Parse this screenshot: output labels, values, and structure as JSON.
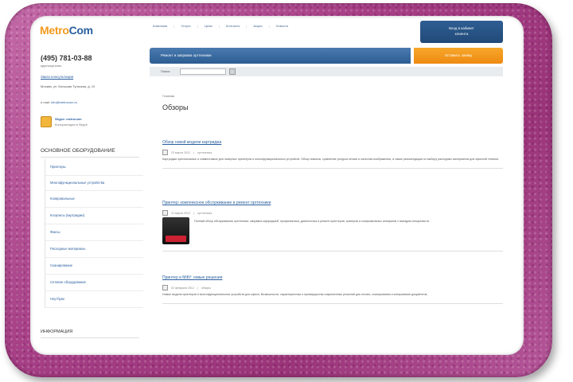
{
  "header": {
    "logo_part1": "Metro",
    "logo_part2": "Com",
    "nav": [
      "Компания",
      "Услуги",
      "Цены",
      "Контакты",
      "Акции",
      "Новости"
    ],
    "login_title": "Вход в кабинет",
    "login_sub": "клиента"
  },
  "contacts": {
    "phone": "(495) 781-03-88",
    "phone_sub": "круглосуточно",
    "order_link": "Заказ консультации",
    "address": "Москва, ул. Большая Тульская, д. 10",
    "email_label": "e-mail:",
    "email": "info@metrocom.ru",
    "skype_title": "Skype: metrocom",
    "skype_sub": "Консультация в Skype"
  },
  "sidebar": {
    "title": "ОСНОВНОЕ ОБОРУДОВАНИЕ",
    "items": [
      "Принтеры",
      "Многофункциональные устройства",
      "Копировальные",
      "Ксероксы (картриджи)",
      "Факсы",
      "Расходные материалы",
      "Сканирование",
      "Сетевое оборудование",
      "Ноутбуки"
    ],
    "bottom_title": "ИНФОРМАЦИЯ"
  },
  "main": {
    "blue_bar": "Ремонт и заправка оргтехники",
    "orange_bar": "Оставить заявку",
    "search_label": "Поиск:",
    "search_value": "",
    "breadcrumb": "Главная",
    "page_title": "Обзоры",
    "articles": [
      {
        "title": "Обзор новой модели картриджа",
        "date": "23 марта 2012",
        "category": "оргтехника",
        "text": "Картриджи оригинальные и совместимые для лазерных принтеров и многофункциональных устройств. Обзор новинок, сравнение ресурса печати и качества изображения, а также рекомендации по выбору расходных материалов для офисной техники."
      },
      {
        "title": "Принтер: комплексное обслуживание и ремонт оргтехники",
        "date": "12 марта 2012",
        "category": "оргтехника",
        "text": "Полный обзор обслуживания оргтехники: заправка картриджей, профилактика, диагностика и ремонт принтеров, сканеров и копировальных аппаратов с выездом специалиста."
      },
      {
        "title": "Принтер и МФУ: новые решения",
        "date": "02 февраля 2012",
        "category": "обзоры",
        "text": "Новые модели принтеров и многофункциональных устройств для офиса. Возможности, характеристики и преимущества современных решений для печати, сканирования и копирования документов."
      }
    ]
  }
}
